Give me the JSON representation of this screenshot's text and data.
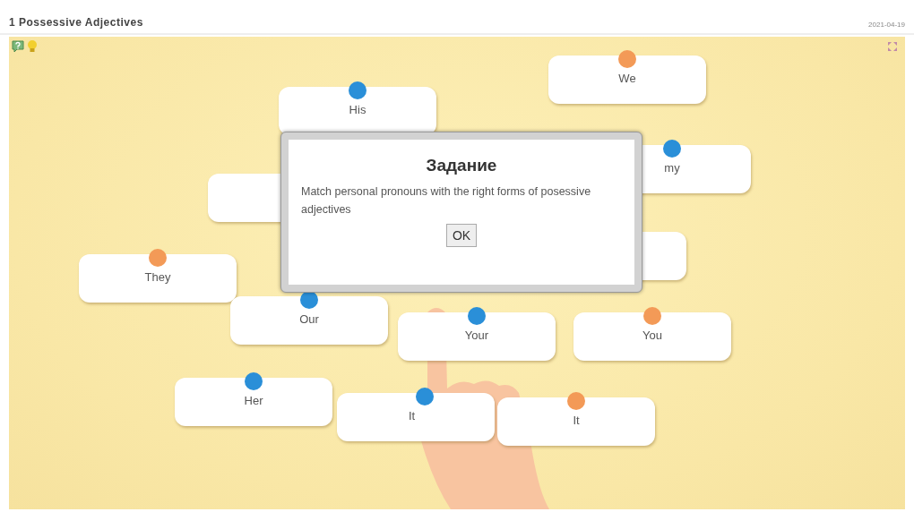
{
  "header": {
    "title": "1 Possessive Adjectives",
    "date": "2021-04-19"
  },
  "cards": [
    {
      "kind": "word",
      "label": "We",
      "color": "#f39a57"
    },
    {
      "kind": "word",
      "label": "His",
      "color": "#2a8fd8"
    },
    {
      "kind": "word",
      "label": "my",
      "color": "#2a8fd8"
    },
    {
      "kind": "hidden"
    },
    {
      "kind": "hidden"
    },
    {
      "kind": "word",
      "label": "They",
      "color": "#f39a57"
    },
    {
      "kind": "word",
      "label": "Our",
      "color": "#2a8fd8"
    },
    {
      "kind": "word",
      "label": "Your",
      "color": "#2a8fd8"
    },
    {
      "kind": "word",
      "label": "You",
      "color": "#f39a57"
    },
    {
      "kind": "word",
      "label": "Her",
      "color": "#2a8fd8"
    },
    {
      "kind": "word",
      "label": "It",
      "color": "#2a8fd8"
    },
    {
      "kind": "word",
      "label": "It",
      "color": "#f39a57"
    }
  ],
  "dialog": {
    "title": "Задание",
    "text": "Match personal pronouns with the right forms of posessive adjectives",
    "button": "OK"
  }
}
